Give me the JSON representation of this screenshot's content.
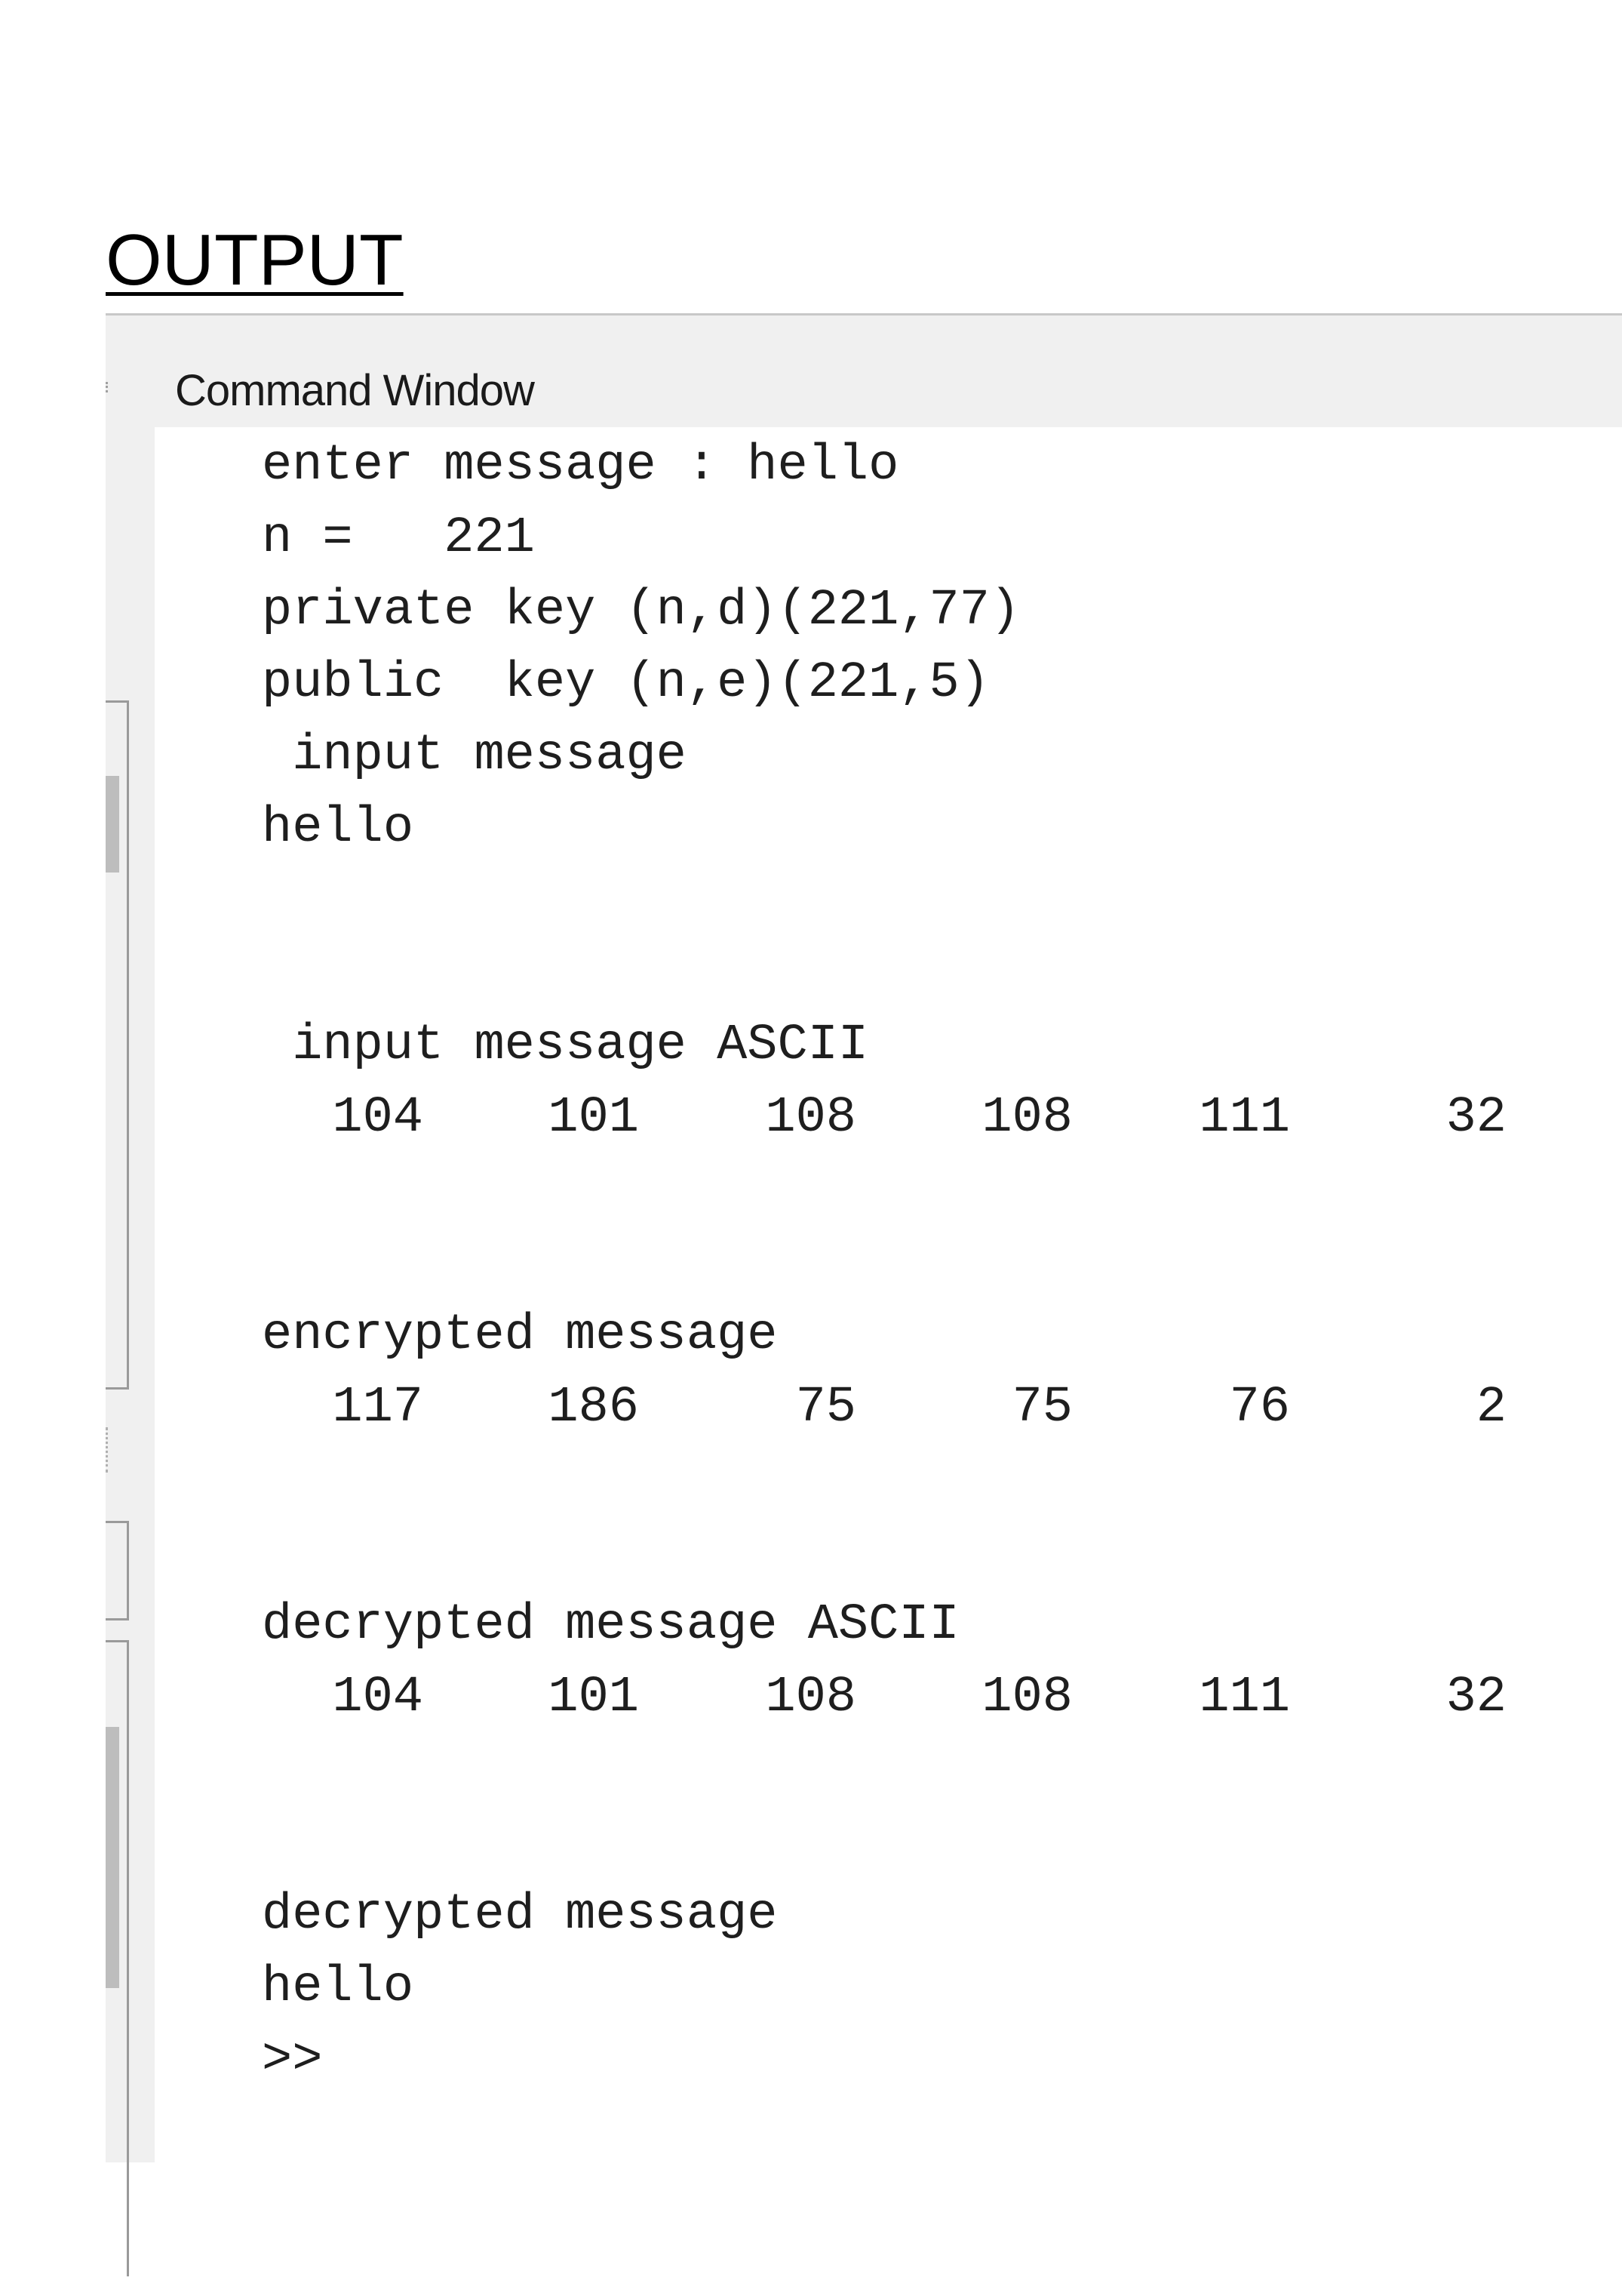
{
  "page": {
    "heading": "OUTPUT"
  },
  "window": {
    "title": "Command Window"
  },
  "console": {
    "lines": [
      "enter message : hello",
      "n =   221",
      "private key (n,d)(221,77)",
      "public  key (n,e)(221,5)",
      " input message",
      "hello",
      " input message ASCII",
      "encrypted message",
      "decrypted message ASCII",
      "decrypted message",
      "hello",
      ">>"
    ],
    "input_ascii": [
      "104",
      "101",
      "108",
      "108",
      "111",
      "32"
    ],
    "encrypted": [
      "117",
      "186",
      "75",
      "75",
      "76",
      "2"
    ],
    "decrypted_ascii": [
      "104",
      "101",
      "108",
      "108",
      "111",
      "32"
    ]
  }
}
